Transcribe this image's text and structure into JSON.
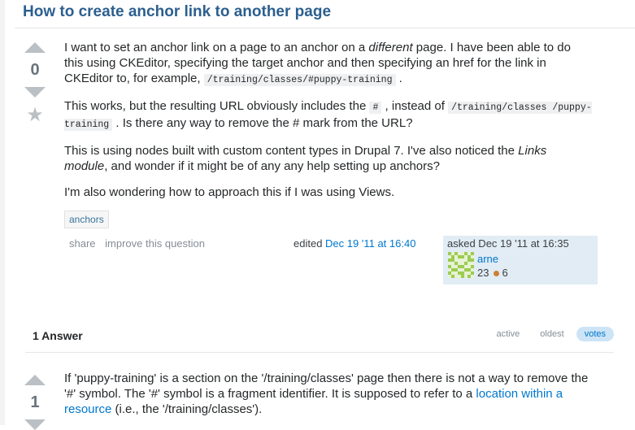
{
  "question": {
    "title": "How to create anchor link to another page",
    "votes": "0",
    "body": {
      "p1_a": "I want to set an anchor link on a page to an anchor on a ",
      "p1_em": "different",
      "p1_b": " page. I have been able to do this using CKEditor, specifying the target anchor and then specifying an href for the link in CKEditor to, for example, ",
      "p1_code": "/training/classes/#puppy-training",
      "p1_c": " .",
      "p2_a": "This works, but the resulting URL obviously includes the ",
      "p2_code1": "#",
      "p2_b": " , instead of ",
      "p2_code2": "/training/classes /puppy-training",
      "p2_c": " . Is there any way to remove the # mark from the URL?",
      "p3_a": "This is using nodes built with custom content types in Drupal 7. I've also noticed the ",
      "p3_em": "Links module",
      "p3_b": ", and wonder if it might be of any any help setting up anchors?",
      "p4": "I'm also wondering how to approach this if I was using Views."
    },
    "tags": [
      "anchors"
    ],
    "menu": {
      "share": "share",
      "improve": "improve this question"
    },
    "edited": {
      "label": "edited",
      "date": "Dec 19 '11 at 16:40"
    },
    "owner": {
      "asked": "asked Dec 19 '11 at 16:35",
      "name": "arne",
      "reputation": "23",
      "bronze_badges": "6"
    }
  },
  "answers": {
    "count_label": "1 Answer",
    "sort_tabs": [
      "active",
      "oldest",
      "votes"
    ],
    "active_sort": "votes",
    "first": {
      "votes": "1",
      "text_a": "If 'puppy-training' is a section on the '/training/classes' page then there is not a way to remove the '#' symbol. The '#' symbol is a fragment identifier. It is supposed to refer to a ",
      "link": "location within a resource",
      "text_b": " (i.e., the '/training/classes')."
    }
  },
  "colors": {
    "title": "#2c5f8e",
    "link": "#0077cc",
    "owner_card": "#e1ecf4",
    "active_tab": "#cce4f6"
  }
}
